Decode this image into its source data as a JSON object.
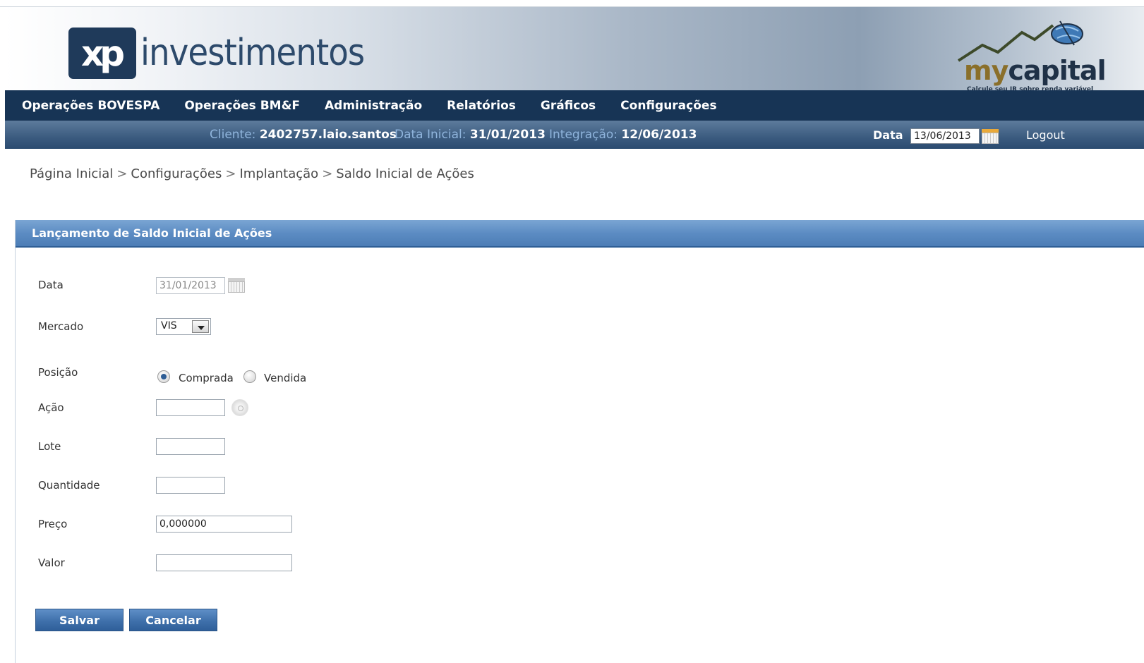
{
  "header": {
    "xp_logo_mark": "xp",
    "xp_logo_word": "investimentos",
    "mycapital_my": "my",
    "mycapital_capital": "capital",
    "mycapital_tagline": "Calcule seu IR sobre renda variável"
  },
  "nav": {
    "items": [
      "Operações BOVESPA",
      "Operações BM&F",
      "Administração",
      "Relatórios",
      "Gráficos",
      "Configurações"
    ]
  },
  "infobar": {
    "cliente_label": "Cliente:",
    "cliente_value": "2402757.laio.santos",
    "data_inicial_label": "Data Inicial:",
    "data_inicial_value": "31/01/2013",
    "integracao_label": "Integração:",
    "integracao_value": "12/06/2013",
    "data_label": "Data",
    "data_value": "13/06/2013",
    "logout": "Logout"
  },
  "breadcrumb": {
    "items": [
      "Página Inicial",
      "Configurações",
      "Implantação",
      "Saldo Inicial de Ações"
    ],
    "separator": ">"
  },
  "form": {
    "title": "Lançamento de Saldo Inicial de Ações",
    "data_label": "Data",
    "data_value": "31/01/2013",
    "mercado_label": "Mercado",
    "mercado_value": "VIS",
    "posicao_label": "Posição",
    "posicao_option_comprada": "Comprada",
    "posicao_option_vendida": "Vendida",
    "posicao_selected": "Comprada",
    "acao_label": "Ação",
    "acao_value": "",
    "lote_label": "Lote",
    "lote_value": "",
    "quantidade_label": "Quantidade",
    "quantidade_value": "",
    "preco_label": "Preço",
    "preco_value": "0,000000",
    "valor_label": "Valor",
    "valor_value": "",
    "salvar_label": "Salvar",
    "cancelar_label": "Cancelar"
  },
  "colors": {
    "nav_bg": "#173455",
    "panel_header": "#5c8cc3",
    "button": "#3f70ab",
    "info_label": "#8fb4dc"
  }
}
